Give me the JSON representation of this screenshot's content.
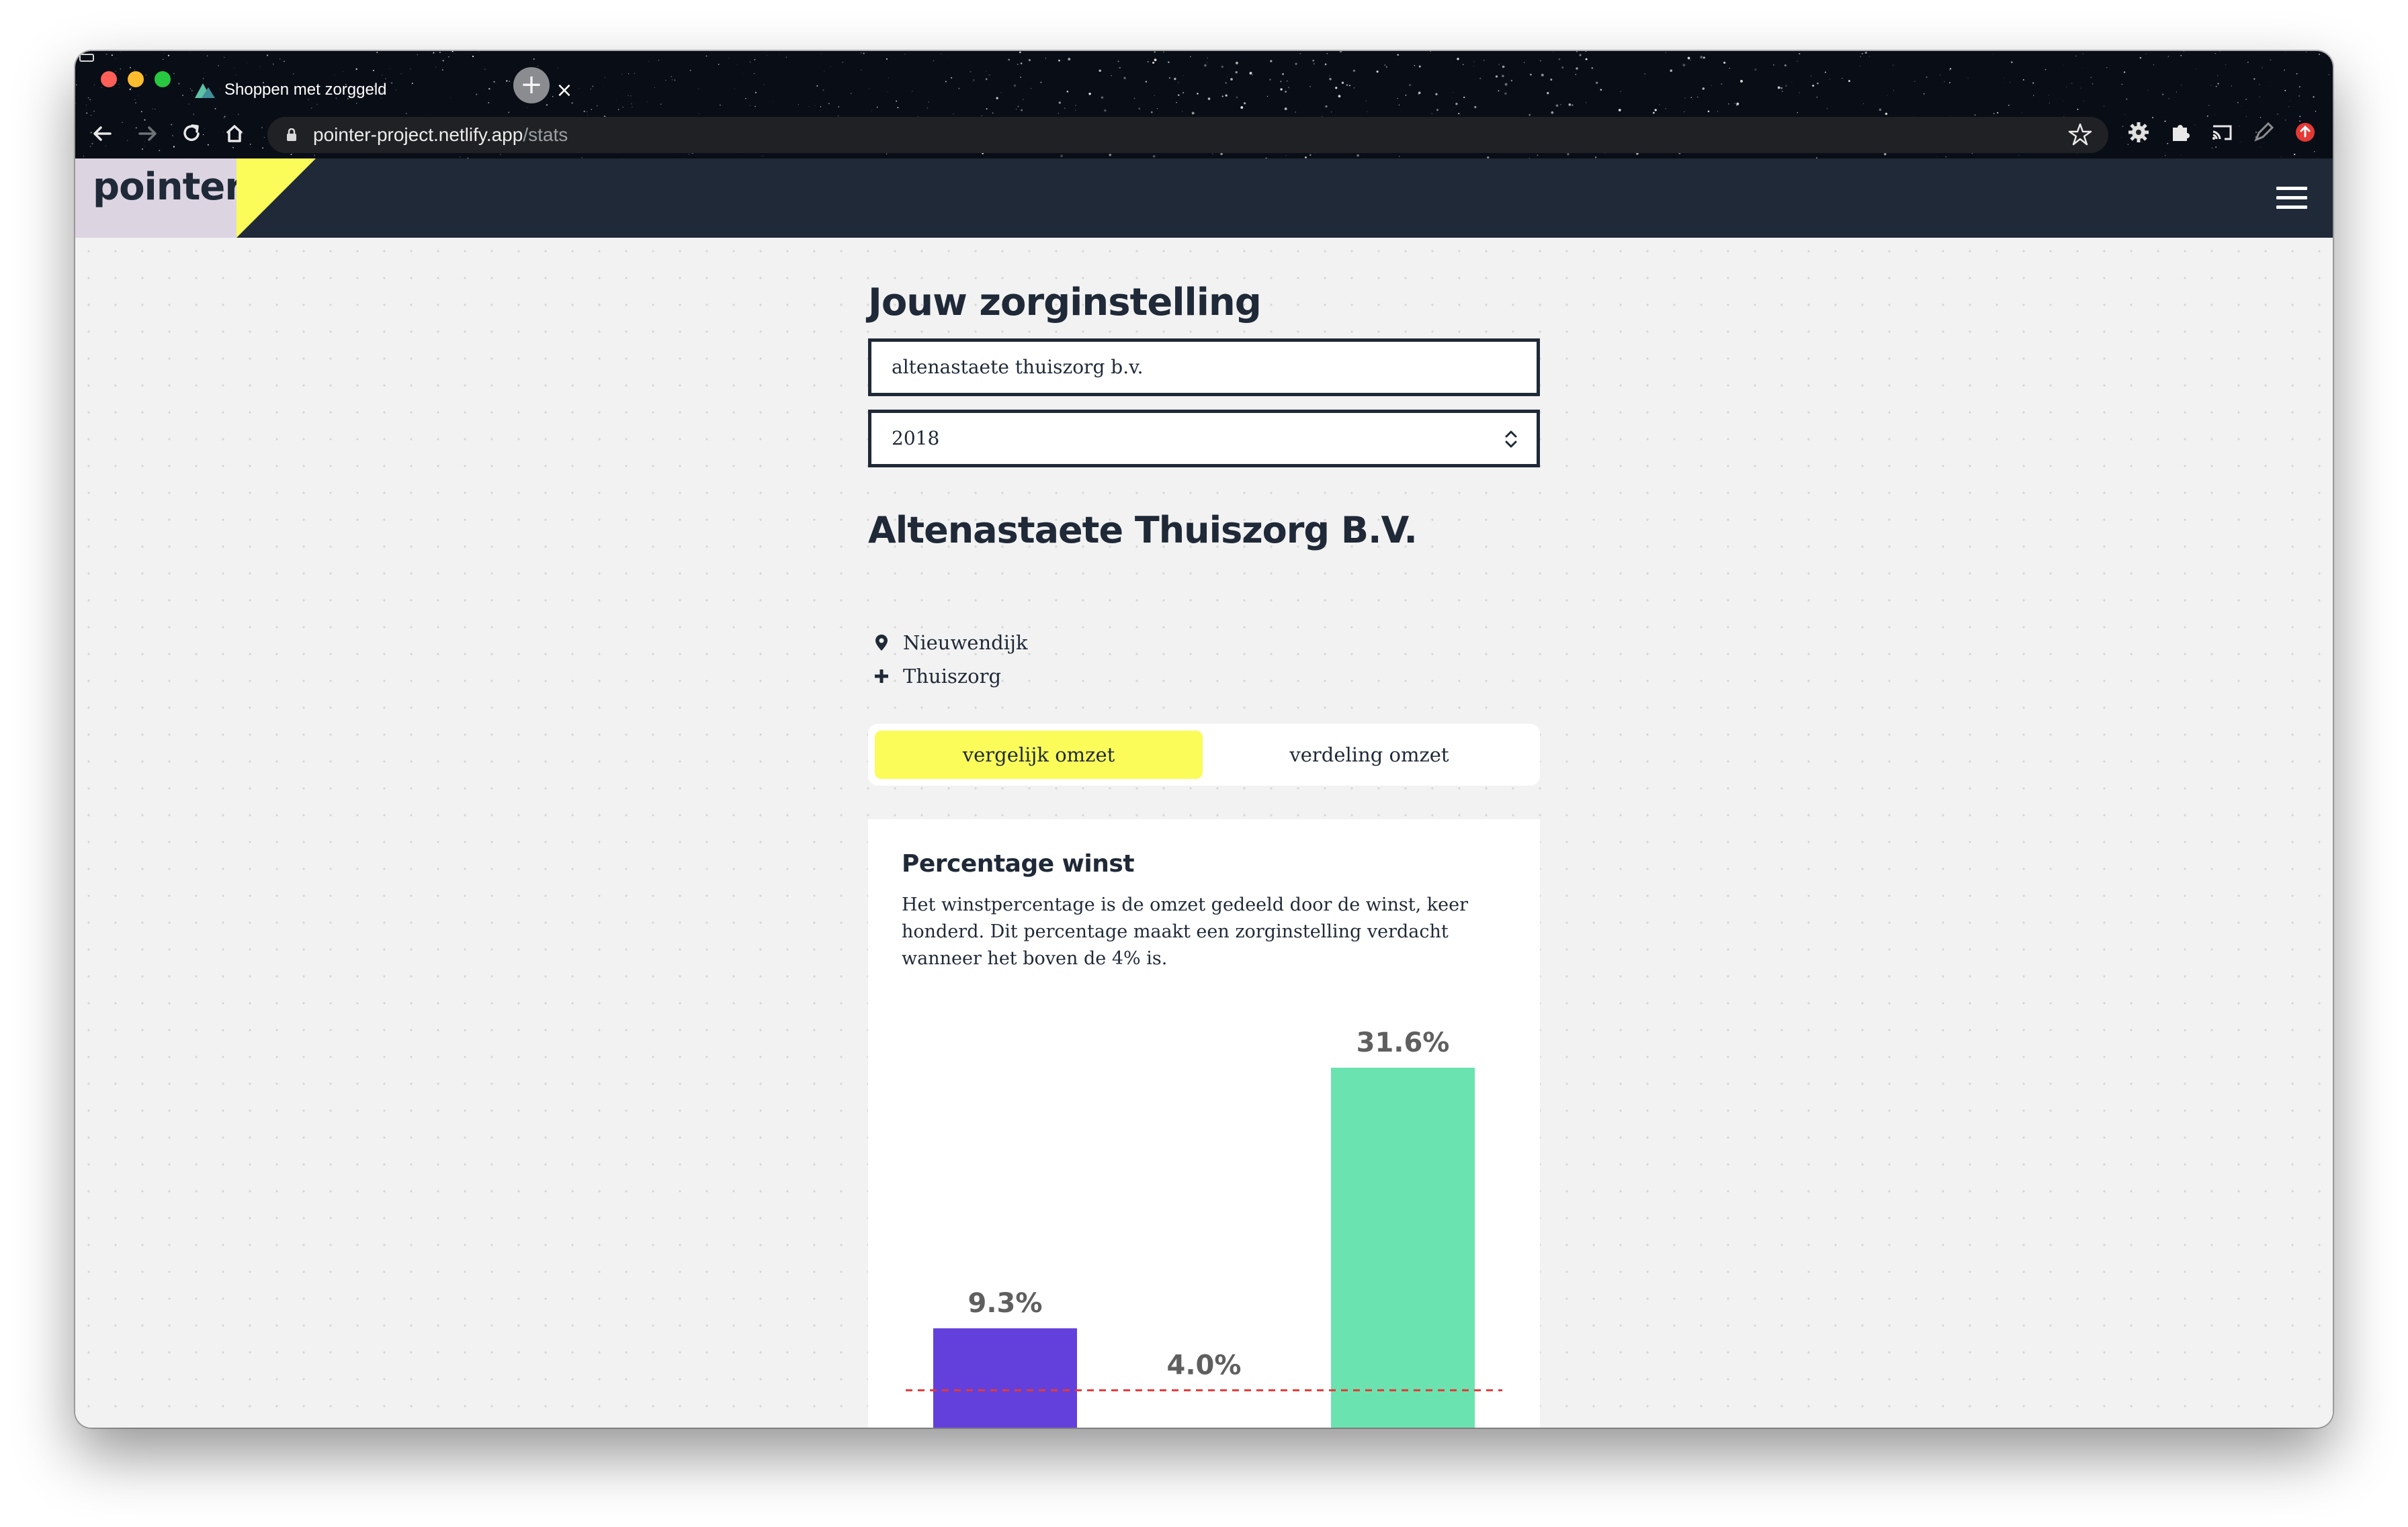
{
  "browser": {
    "tab_title": "Shoppen met zorggeld",
    "tab_close": "×",
    "new_tab": "+",
    "url_host": "pointer-project.netlify.app",
    "url_path": "/stats"
  },
  "site": {
    "logo": "pointer",
    "accent_color": "#fbfc5a",
    "header_color": "#1f2937"
  },
  "search": {
    "title": "Jouw zorginstelling",
    "value": "altenastaete thuiszorg b.v.",
    "year": "2018"
  },
  "organization": {
    "name": "Altenastaete Thuiszorg B.V.",
    "location": "Nieuwendijk",
    "sector": "Thuiszorg"
  },
  "tabs": {
    "compare": "vergelijk omzet",
    "distribution": "verdeling omzet",
    "active": "compare"
  },
  "card": {
    "title": "Percentage winst",
    "description": "Het winstpercentage is de omzet gedeeld door de winst, keer honderd. Dit percentage maakt een zorginstelling verdacht wanneer het boven de 4% is."
  },
  "chart_data": {
    "type": "bar",
    "values": [
      9.3,
      4.0,
      31.6
    ],
    "labels": [
      "9.3%",
      "4.0%",
      "31.6%"
    ],
    "colors": [
      "#6340dc",
      null,
      "#6be3b0"
    ],
    "threshold": 4.0,
    "threshold_color": "#e53935",
    "label_color": "#5f5f5f"
  }
}
